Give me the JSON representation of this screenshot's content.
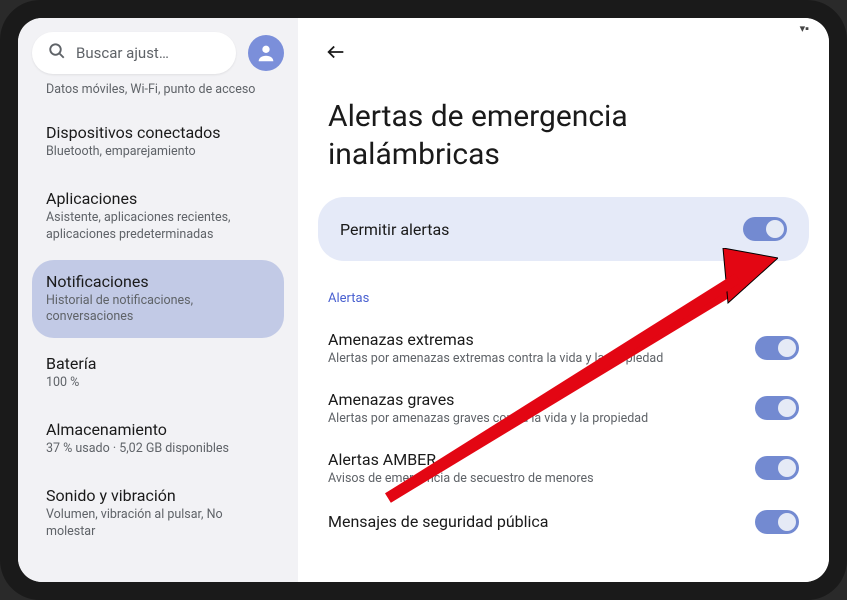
{
  "search": {
    "placeholder": "Buscar ajust…"
  },
  "sidebar": {
    "partial_top_subtitle": "Datos móviles, Wi-Fi, punto de acceso",
    "items": [
      {
        "title": "Dispositivos conectados",
        "subtitle": "Bluetooth, emparejamiento",
        "active": false
      },
      {
        "title": "Aplicaciones",
        "subtitle": "Asistente, aplicaciones recientes, aplicaciones predeterminadas",
        "active": false
      },
      {
        "title": "Notificaciones",
        "subtitle": "Historial de notificaciones, conversaciones",
        "active": true
      },
      {
        "title": "Batería",
        "subtitle": "100 %",
        "active": false
      },
      {
        "title": "Almacenamiento",
        "subtitle": "37 % usado · 5,02 GB disponibles",
        "active": false
      },
      {
        "title": "Sonido y vibración",
        "subtitle": "Volumen, vibración al pulsar, No molestar",
        "active": false
      }
    ]
  },
  "main": {
    "title": "Alertas de emergencia inalámbricas",
    "permit_label": "Permitir alertas",
    "section_header": "Alertas",
    "settings": [
      {
        "title": "Amenazas extremas",
        "desc": "Alertas por amenazas extremas contra la vida y la propiedad"
      },
      {
        "title": "Amenazas graves",
        "desc": "Alertas por amenazas graves contra la vida y la propiedad"
      },
      {
        "title": "Alertas AMBER",
        "desc": "Avisos de emergencia de secuestro de menores"
      },
      {
        "title": "Mensajes de seguridad pública",
        "desc": ""
      }
    ]
  },
  "colors": {
    "sidebar_bg": "#f2f2f5",
    "active_bg": "#c2cae6",
    "card_bg": "#e5eaf8",
    "toggle_on": "#738ad1",
    "accent": "#4960d0",
    "arrow": "#e30613"
  }
}
